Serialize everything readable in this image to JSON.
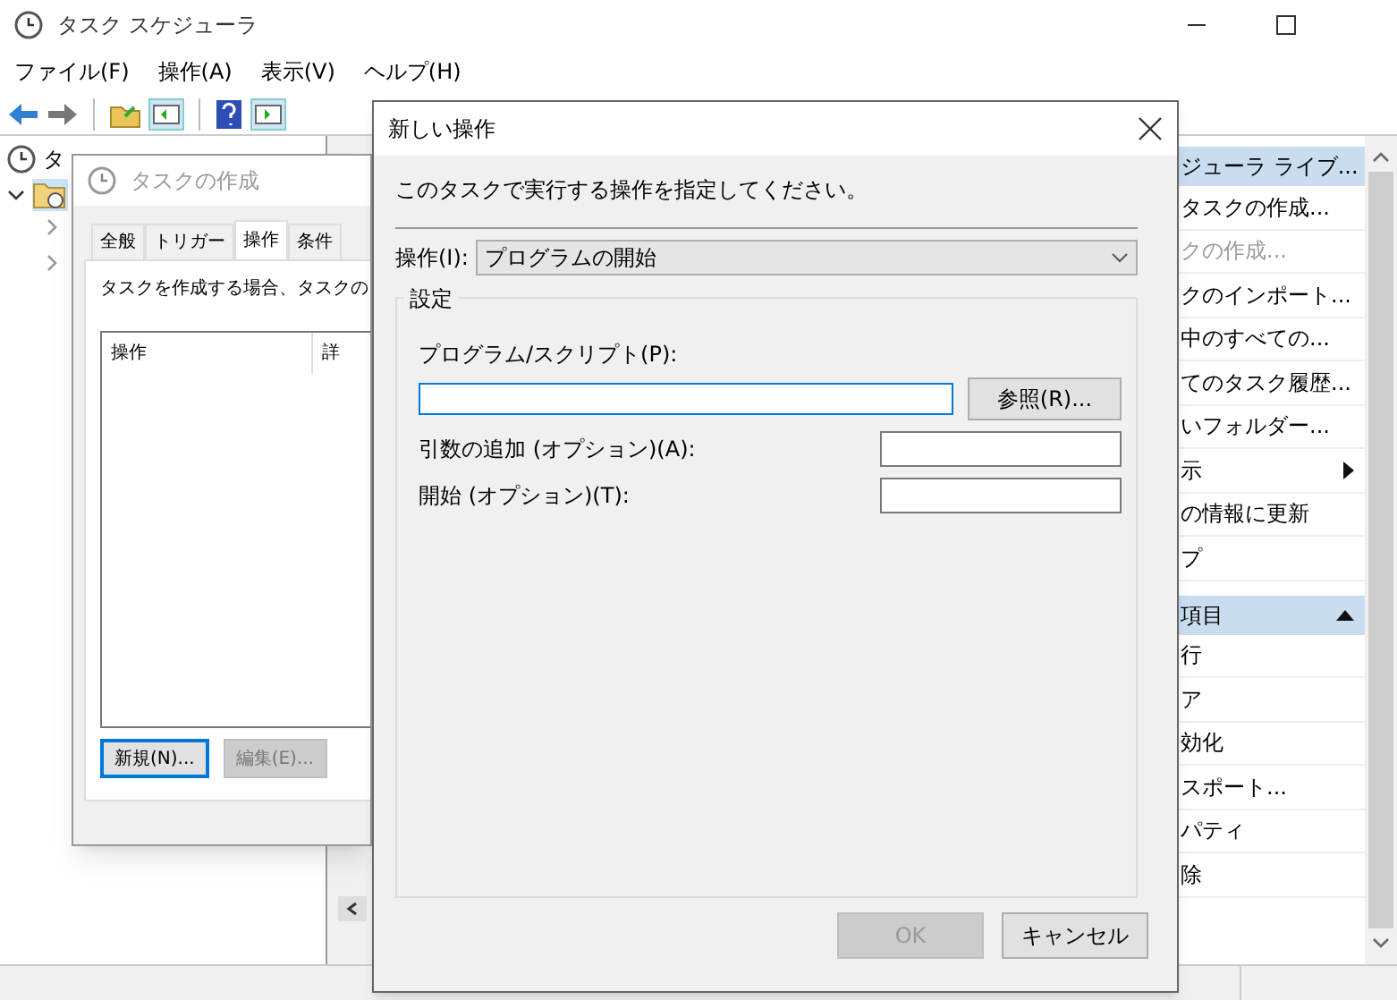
{
  "window": {
    "title": "タスク スケジューラ"
  },
  "menu": [
    "ファイル(F)",
    "操作(A)",
    "表示(V)",
    "ヘルプ(H)"
  ],
  "tree": {
    "root": "タ",
    "expanded": true
  },
  "create_dialog": {
    "title": "タスクの作成",
    "tabs": [
      {
        "label": "全般",
        "selected": false
      },
      {
        "label": "トリガー",
        "selected": false
      },
      {
        "label": "操作",
        "selected": true
      },
      {
        "label": "条件",
        "selected": false
      }
    ],
    "description": "タスクを作成する場合、タスクの",
    "columns": [
      "操作",
      "詳"
    ],
    "buttons": [
      {
        "label": "新規(N)...",
        "disabled": false
      },
      {
        "label": "編集(E)...",
        "disabled": true
      }
    ]
  },
  "actions_pane": {
    "sections": [
      {
        "header": "ジューラ ライブ...",
        "expanded": true,
        "items": [
          {
            "label": "タスクの作成...",
            "disabled": false,
            "kind": "action"
          },
          {
            "label": "クの作成...",
            "disabled": true,
            "kind": "action"
          },
          {
            "label": "クのインポート...",
            "disabled": false,
            "kind": "action"
          },
          {
            "label": "中のすべての...",
            "disabled": false,
            "kind": "action"
          },
          {
            "label": "てのタスク履歴...",
            "disabled": false,
            "kind": "action"
          },
          {
            "label": "いフォルダー...",
            "disabled": false,
            "kind": "action"
          },
          {
            "label": "示",
            "disabled": false,
            "kind": "submenu"
          },
          {
            "label": "の情報に更新",
            "disabled": false,
            "kind": "action"
          },
          {
            "label": "プ",
            "disabled": false,
            "kind": "action"
          }
        ]
      },
      {
        "header": "項目",
        "expanded": true,
        "items": [
          {
            "label": "行",
            "disabled": false,
            "kind": "action"
          },
          {
            "label": "ア",
            "disabled": false,
            "kind": "action"
          },
          {
            "label": "効化",
            "disabled": false,
            "kind": "action"
          },
          {
            "label": "スポート...",
            "disabled": false,
            "kind": "action"
          },
          {
            "label": "パティ",
            "disabled": false,
            "kind": "action"
          },
          {
            "label": "除",
            "disabled": false,
            "kind": "action"
          }
        ]
      }
    ]
  },
  "new_action_dialog": {
    "title": "新しい操作",
    "instruction": "このタスクで実行する操作を指定してください。",
    "action_label": "操作(I):",
    "action_value": "プログラムの開始",
    "group": "設定",
    "program_label": "プログラム/スクリプト(P):",
    "browse": "参照(R)...",
    "arguments_label": "引数の追加 (オプション)(A):",
    "start_label": "開始 (オプション)(T):",
    "buttons": [
      {
        "label": "OK",
        "disabled": true
      },
      {
        "label": "キャンセル",
        "disabled": false
      }
    ]
  }
}
